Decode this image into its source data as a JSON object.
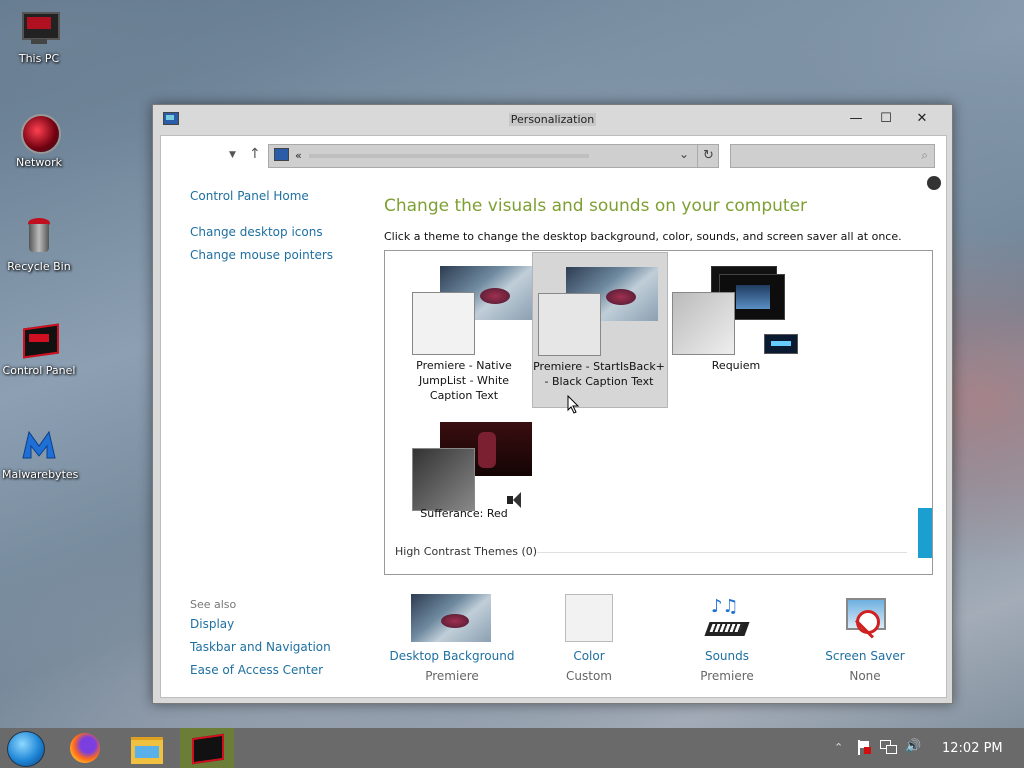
{
  "desktop": {
    "icons": [
      {
        "label": "This PC"
      },
      {
        "label": "Network"
      },
      {
        "label": "Recycle Bin"
      },
      {
        "label": "Control Panel"
      },
      {
        "label": "Malwarebytes"
      }
    ]
  },
  "window": {
    "title": "Personalization",
    "address_prefix": "«",
    "controls": {
      "minimize": "—",
      "maximize": "☐",
      "close": "✕"
    }
  },
  "sidebar": {
    "links": [
      {
        "label": "Control Panel Home"
      },
      {
        "label": "Change desktop icons"
      },
      {
        "label": "Change mouse pointers"
      }
    ],
    "see_also_title": "See also",
    "see_also": [
      {
        "label": "Display"
      },
      {
        "label": "Taskbar and Navigation"
      },
      {
        "label": "Ease of Access Center"
      }
    ]
  },
  "main": {
    "heading": "Change the visuals and sounds on your computer",
    "subheading": "Click a theme to change the desktop background, color, sounds, and screen saver all at once.",
    "themes": [
      {
        "label": "Premiere - Native JumpList - White Caption Text",
        "selected": false
      },
      {
        "label": "Premiere - StartIsBack+ - Black Caption Text",
        "selected": true
      },
      {
        "label": "Requiem",
        "selected": false
      },
      {
        "label": "Sufferance: Red",
        "selected": false
      }
    ],
    "high_contrast": "High Contrast Themes (0)"
  },
  "bottom": [
    {
      "name": "Desktop Background",
      "value": "Premiere"
    },
    {
      "name": "Color",
      "value": "Custom"
    },
    {
      "name": "Sounds",
      "value": "Premiere"
    },
    {
      "name": "Screen Saver",
      "value": "None"
    }
  ],
  "taskbar": {
    "clock": "12:02 PM",
    "items": [
      "start-orb",
      "firefox",
      "file-explorer",
      "control-panel"
    ]
  },
  "colors": {
    "accent_green": "#7ea032",
    "link_blue": "#1e6fa0",
    "scroll_blue": "#1a9fd0",
    "taskbar_active": "#6b7d37"
  }
}
